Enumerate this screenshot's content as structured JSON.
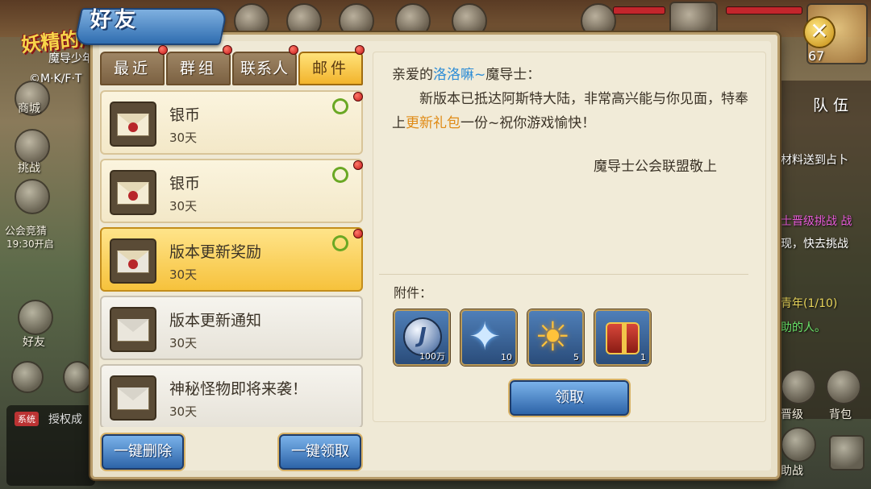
{
  "background": {
    "logo_main": "妖精的尾巴",
    "logo_sub": "魔导少年",
    "copyright": "©M·K/F·T",
    "left_menu": {
      "shop": "商城",
      "challenge": "挑战",
      "guild_race": "公会竞猜",
      "guild_race_time": "19:30开启",
      "friends": "好友"
    },
    "system_tag": "系统",
    "system_text": "授权成",
    "level": "67",
    "right_tab": "队伍",
    "right_texts": [
      "材料送到占卜",
      "士晋级挑战 战",
      "现，快去挑战",
      "青年(1/10)",
      "助的人。"
    ],
    "right_buttons": [
      "晋级",
      "背包",
      "助战"
    ]
  },
  "dialog": {
    "title": "好友",
    "close_glyph": "✕",
    "tabs": [
      {
        "label": "最近",
        "active": false
      },
      {
        "label": "群组",
        "active": false
      },
      {
        "label": "联系人",
        "active": false
      },
      {
        "label": "邮件",
        "active": true
      }
    ],
    "mails": [
      {
        "title": "银币",
        "days": "30天",
        "state": "unread",
        "attachment": true
      },
      {
        "title": "银币",
        "days": "30天",
        "state": "unread",
        "attachment": true
      },
      {
        "title": "版本更新奖励",
        "days": "30天",
        "state": "selected",
        "attachment": true
      },
      {
        "title": "版本更新通知",
        "days": "30天",
        "state": "read",
        "attachment": false
      },
      {
        "title": "神秘怪物即将来袭！",
        "days": "30天",
        "state": "read",
        "attachment": false
      }
    ],
    "delete_all": "一键删除",
    "claim_all": "一键领取",
    "letter": {
      "greeting_prefix": "亲爱的",
      "recipient": "洛洛嘛~",
      "greeting_suffix": "魔导士：",
      "body_part1": "新版本已抵达阿斯特大陆，非常高兴能与你见面，特奉上",
      "gift": "更新礼包",
      "body_part2": "一份~祝你游戏愉快！",
      "signature": "魔导士公会联盟敬上"
    },
    "attachments_label": "附件：",
    "attachments": [
      {
        "icon": "silver-coin-icon",
        "glyph": "J",
        "count": "100万"
      },
      {
        "icon": "blue-star-crystal-icon",
        "glyph": "✦",
        "count": "10"
      },
      {
        "icon": "sun-crystal-icon",
        "glyph": "☀",
        "count": "5"
      },
      {
        "icon": "gift-chest-icon",
        "glyph": "",
        "count": "1"
      }
    ],
    "claim_button": "领取"
  },
  "colors": {
    "accent_blue": "#2c8cd6",
    "accent_orange": "#e08a14",
    "tab_active": "#f2b42c",
    "button_blue": "#2d64a8"
  }
}
